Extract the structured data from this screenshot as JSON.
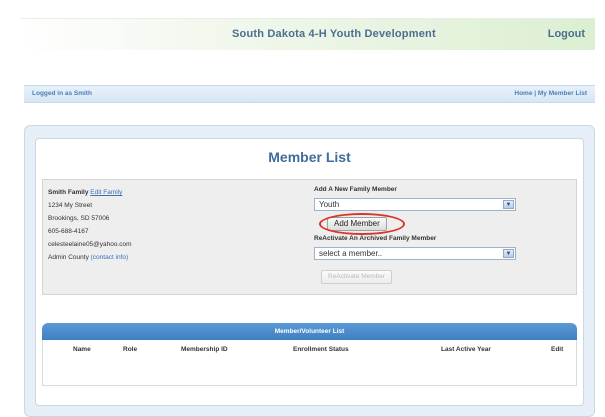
{
  "header": {
    "title": "South Dakota 4-H Youth Development",
    "logout_label": "Logout"
  },
  "infobar": {
    "logged_in": "Logged in as Smith",
    "home": "Home",
    "separator": " | ",
    "my_member_list": "My Member List"
  },
  "main": {
    "title": "Member List"
  },
  "family": {
    "name": "Smith Family",
    "edit_link": "Edit Family",
    "street": "1234 My Street",
    "city": "Brookings, SD 57006",
    "phone": "605-688-4167",
    "email": "celesteelaine05@yahoo.com",
    "county": "Admin County",
    "contact_link": "(contact info)"
  },
  "add_member": {
    "header": "Add A New Family Member",
    "type_selected": "Youth",
    "button": "Add Member"
  },
  "reactivate": {
    "header": "ReActivate An Archived Family Member",
    "select_placeholder": "select a member..",
    "button": "ReActivate Member"
  },
  "volunteer_list": {
    "title": "Member/Volunteer List",
    "columns": [
      "Name",
      "Role",
      "Membership ID",
      "Enrollment Status",
      "Last Active Year",
      "Edit"
    ]
  },
  "colors": {
    "highlight_circle": "#d9352a",
    "table_header": "#4a8ccb",
    "title_blue": "#3f6e9c"
  }
}
